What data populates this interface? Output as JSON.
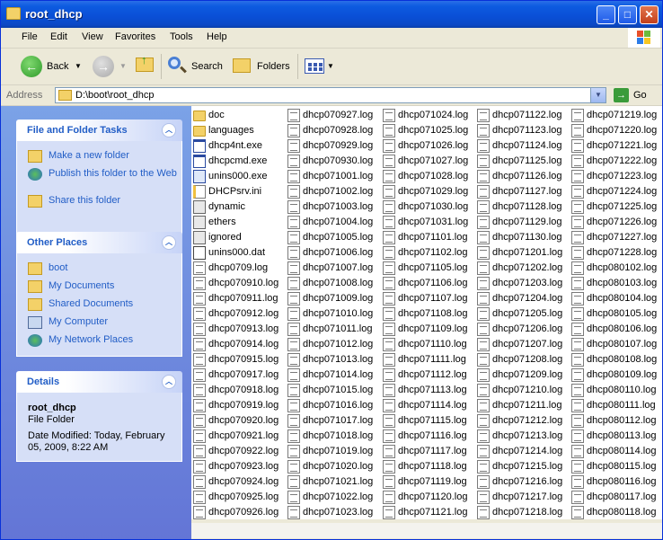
{
  "window": {
    "title": "root_dhcp",
    "controls": [
      "_",
      "□",
      "✕"
    ]
  },
  "menu": [
    "File",
    "Edit",
    "View",
    "Favorites",
    "Tools",
    "Help"
  ],
  "toolbar": {
    "back": "Back",
    "search": "Search",
    "folders": "Folders"
  },
  "address": {
    "label": "Address",
    "value": "D:\\boot\\root_dhcp",
    "go": "Go"
  },
  "tasks": {
    "title": "File and Folder Tasks",
    "items": [
      "Make a new folder",
      "Publish this folder to the Web",
      "Share this folder"
    ]
  },
  "places": {
    "title": "Other Places",
    "items": [
      "boot",
      "My Documents",
      "Shared Documents",
      "My Computer",
      "My Network Places"
    ]
  },
  "details": {
    "title": "Details",
    "name": "root_dhcp",
    "type": "File Folder",
    "modified": "Date Modified: Today, February 05, 2009, 8:22 AM"
  },
  "files": [
    [
      {
        "name": "doc",
        "icon": "folder"
      },
      {
        "name": "languages",
        "icon": "folder"
      },
      {
        "name": "dhcp4nt.exe",
        "icon": "exe"
      },
      {
        "name": "dhcpcmd.exe",
        "icon": "exe"
      },
      {
        "name": "unins000.exe",
        "icon": "unins"
      },
      {
        "name": "DHCPsrv.ini",
        "icon": "ini"
      },
      {
        "name": "dynamic",
        "icon": "dll"
      },
      {
        "name": "ethers",
        "icon": "dll"
      },
      {
        "name": "ignored",
        "icon": "dll"
      },
      {
        "name": "unins000.dat",
        "icon": "dat"
      },
      {
        "name": "dhcp0709.log",
        "icon": "log"
      },
      {
        "name": "dhcp070910.log",
        "icon": "log"
      },
      {
        "name": "dhcp070911.log",
        "icon": "log"
      },
      {
        "name": "dhcp070912.log",
        "icon": "log"
      },
      {
        "name": "dhcp070913.log",
        "icon": "log"
      },
      {
        "name": "dhcp070914.log",
        "icon": "log"
      },
      {
        "name": "dhcp070915.log",
        "icon": "log"
      },
      {
        "name": "dhcp070917.log",
        "icon": "log"
      },
      {
        "name": "dhcp070918.log",
        "icon": "log"
      },
      {
        "name": "dhcp070919.log",
        "icon": "log"
      },
      {
        "name": "dhcp070920.log",
        "icon": "log"
      },
      {
        "name": "dhcp070921.log",
        "icon": "log"
      },
      {
        "name": "dhcp070922.log",
        "icon": "log"
      },
      {
        "name": "dhcp070923.log",
        "icon": "log"
      },
      {
        "name": "dhcp070924.log",
        "icon": "log"
      },
      {
        "name": "dhcp070925.log",
        "icon": "log"
      },
      {
        "name": "dhcp070926.log",
        "icon": "log"
      }
    ],
    [
      {
        "name": "dhcp070927.log",
        "icon": "log"
      },
      {
        "name": "dhcp070928.log",
        "icon": "log"
      },
      {
        "name": "dhcp070929.log",
        "icon": "log"
      },
      {
        "name": "dhcp070930.log",
        "icon": "log"
      },
      {
        "name": "dhcp071001.log",
        "icon": "log"
      },
      {
        "name": "dhcp071002.log",
        "icon": "log"
      },
      {
        "name": "dhcp071003.log",
        "icon": "log"
      },
      {
        "name": "dhcp071004.log",
        "icon": "log"
      },
      {
        "name": "dhcp071005.log",
        "icon": "log"
      },
      {
        "name": "dhcp071006.log",
        "icon": "log"
      },
      {
        "name": "dhcp071007.log",
        "icon": "log"
      },
      {
        "name": "dhcp071008.log",
        "icon": "log"
      },
      {
        "name": "dhcp071009.log",
        "icon": "log"
      },
      {
        "name": "dhcp071010.log",
        "icon": "log"
      },
      {
        "name": "dhcp071011.log",
        "icon": "log"
      },
      {
        "name": "dhcp071012.log",
        "icon": "log"
      },
      {
        "name": "dhcp071013.log",
        "icon": "log"
      },
      {
        "name": "dhcp071014.log",
        "icon": "log"
      },
      {
        "name": "dhcp071015.log",
        "icon": "log"
      },
      {
        "name": "dhcp071016.log",
        "icon": "log"
      },
      {
        "name": "dhcp071017.log",
        "icon": "log"
      },
      {
        "name": "dhcp071018.log",
        "icon": "log"
      },
      {
        "name": "dhcp071019.log",
        "icon": "log"
      },
      {
        "name": "dhcp071020.log",
        "icon": "log"
      },
      {
        "name": "dhcp071021.log",
        "icon": "log"
      },
      {
        "name": "dhcp071022.log",
        "icon": "log"
      },
      {
        "name": "dhcp071023.log",
        "icon": "log"
      }
    ],
    [
      {
        "name": "dhcp071024.log",
        "icon": "log"
      },
      {
        "name": "dhcp071025.log",
        "icon": "log"
      },
      {
        "name": "dhcp071026.log",
        "icon": "log"
      },
      {
        "name": "dhcp071027.log",
        "icon": "log"
      },
      {
        "name": "dhcp071028.log",
        "icon": "log"
      },
      {
        "name": "dhcp071029.log",
        "icon": "log"
      },
      {
        "name": "dhcp071030.log",
        "icon": "log"
      },
      {
        "name": "dhcp071031.log",
        "icon": "log"
      },
      {
        "name": "dhcp071101.log",
        "icon": "log"
      },
      {
        "name": "dhcp071102.log",
        "icon": "log"
      },
      {
        "name": "dhcp071105.log",
        "icon": "log"
      },
      {
        "name": "dhcp071106.log",
        "icon": "log"
      },
      {
        "name": "dhcp071107.log",
        "icon": "log"
      },
      {
        "name": "dhcp071108.log",
        "icon": "log"
      },
      {
        "name": "dhcp071109.log",
        "icon": "log"
      },
      {
        "name": "dhcp071110.log",
        "icon": "log"
      },
      {
        "name": "dhcp071111.log",
        "icon": "log"
      },
      {
        "name": "dhcp071112.log",
        "icon": "log"
      },
      {
        "name": "dhcp071113.log",
        "icon": "log"
      },
      {
        "name": "dhcp071114.log",
        "icon": "log"
      },
      {
        "name": "dhcp071115.log",
        "icon": "log"
      },
      {
        "name": "dhcp071116.log",
        "icon": "log"
      },
      {
        "name": "dhcp071117.log",
        "icon": "log"
      },
      {
        "name": "dhcp071118.log",
        "icon": "log"
      },
      {
        "name": "dhcp071119.log",
        "icon": "log"
      },
      {
        "name": "dhcp071120.log",
        "icon": "log"
      },
      {
        "name": "dhcp071121.log",
        "icon": "log"
      }
    ],
    [
      {
        "name": "dhcp071122.log",
        "icon": "log"
      },
      {
        "name": "dhcp071123.log",
        "icon": "log"
      },
      {
        "name": "dhcp071124.log",
        "icon": "log"
      },
      {
        "name": "dhcp071125.log",
        "icon": "log"
      },
      {
        "name": "dhcp071126.log",
        "icon": "log"
      },
      {
        "name": "dhcp071127.log",
        "icon": "log"
      },
      {
        "name": "dhcp071128.log",
        "icon": "log"
      },
      {
        "name": "dhcp071129.log",
        "icon": "log"
      },
      {
        "name": "dhcp071130.log",
        "icon": "log"
      },
      {
        "name": "dhcp071201.log",
        "icon": "log"
      },
      {
        "name": "dhcp071202.log",
        "icon": "log"
      },
      {
        "name": "dhcp071203.log",
        "icon": "log"
      },
      {
        "name": "dhcp071204.log",
        "icon": "log"
      },
      {
        "name": "dhcp071205.log",
        "icon": "log"
      },
      {
        "name": "dhcp071206.log",
        "icon": "log"
      },
      {
        "name": "dhcp071207.log",
        "icon": "log"
      },
      {
        "name": "dhcp071208.log",
        "icon": "log"
      },
      {
        "name": "dhcp071209.log",
        "icon": "log"
      },
      {
        "name": "dhcp071210.log",
        "icon": "log"
      },
      {
        "name": "dhcp071211.log",
        "icon": "log"
      },
      {
        "name": "dhcp071212.log",
        "icon": "log"
      },
      {
        "name": "dhcp071213.log",
        "icon": "log"
      },
      {
        "name": "dhcp071214.log",
        "icon": "log"
      },
      {
        "name": "dhcp071215.log",
        "icon": "log"
      },
      {
        "name": "dhcp071216.log",
        "icon": "log"
      },
      {
        "name": "dhcp071217.log",
        "icon": "log"
      },
      {
        "name": "dhcp071218.log",
        "icon": "log"
      }
    ],
    [
      {
        "name": "dhcp071219.log",
        "icon": "log"
      },
      {
        "name": "dhcp071220.log",
        "icon": "log"
      },
      {
        "name": "dhcp071221.log",
        "icon": "log"
      },
      {
        "name": "dhcp071222.log",
        "icon": "log"
      },
      {
        "name": "dhcp071223.log",
        "icon": "log"
      },
      {
        "name": "dhcp071224.log",
        "icon": "log"
      },
      {
        "name": "dhcp071225.log",
        "icon": "log"
      },
      {
        "name": "dhcp071226.log",
        "icon": "log"
      },
      {
        "name": "dhcp071227.log",
        "icon": "log"
      },
      {
        "name": "dhcp071228.log",
        "icon": "log"
      },
      {
        "name": "dhcp080102.log",
        "icon": "log"
      },
      {
        "name": "dhcp080103.log",
        "icon": "log"
      },
      {
        "name": "dhcp080104.log",
        "icon": "log"
      },
      {
        "name": "dhcp080105.log",
        "icon": "log"
      },
      {
        "name": "dhcp080106.log",
        "icon": "log"
      },
      {
        "name": "dhcp080107.log",
        "icon": "log"
      },
      {
        "name": "dhcp080108.log",
        "icon": "log"
      },
      {
        "name": "dhcp080109.log",
        "icon": "log"
      },
      {
        "name": "dhcp080110.log",
        "icon": "log"
      },
      {
        "name": "dhcp080111.log",
        "icon": "log"
      },
      {
        "name": "dhcp080112.log",
        "icon": "log"
      },
      {
        "name": "dhcp080113.log",
        "icon": "log"
      },
      {
        "name": "dhcp080114.log",
        "icon": "log"
      },
      {
        "name": "dhcp080115.log",
        "icon": "log"
      },
      {
        "name": "dhcp080116.log",
        "icon": "log"
      },
      {
        "name": "dhcp080117.log",
        "icon": "log"
      },
      {
        "name": "dhcp080118.log",
        "icon": "log"
      }
    ]
  ]
}
